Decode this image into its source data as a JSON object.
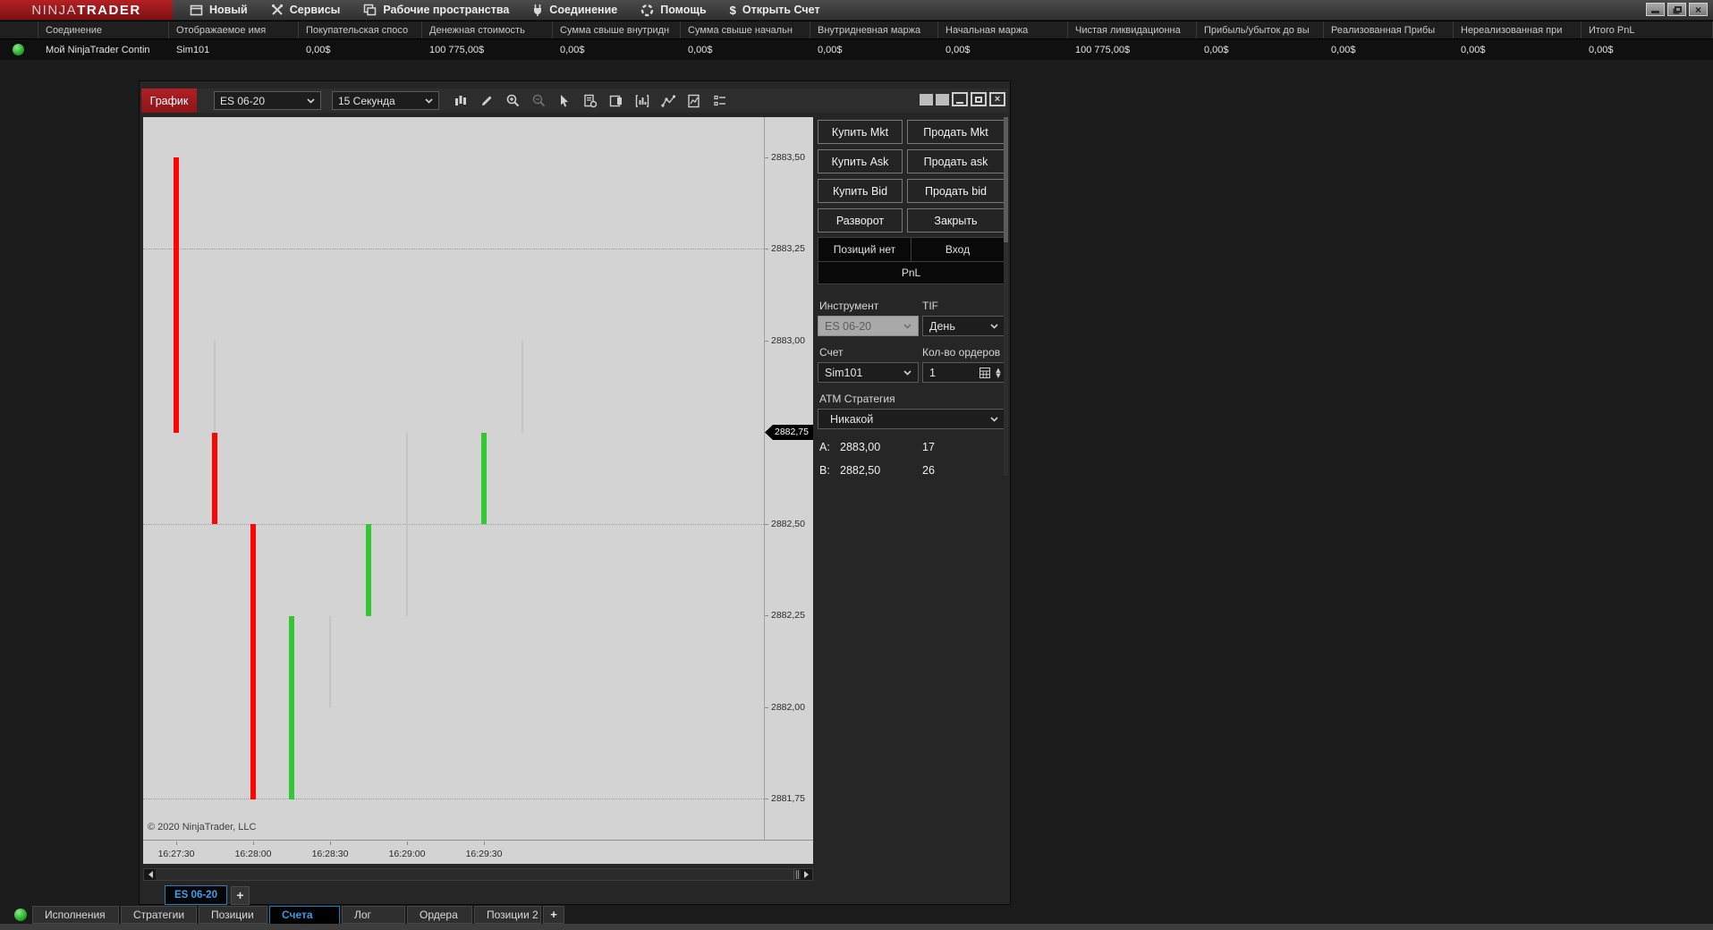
{
  "app": {
    "logo": {
      "ninja": "NINJA",
      "trader": "TRADER"
    },
    "menu": [
      {
        "label": "Новый",
        "icon": "new-window-icon"
      },
      {
        "label": "Сервисы",
        "icon": "tools-icon"
      },
      {
        "label": "Рабочие пространства",
        "icon": "workspaces-icon"
      },
      {
        "label": "Соединение",
        "icon": "plug-icon"
      },
      {
        "label": "Помощь",
        "icon": "help-icon"
      },
      {
        "label": "Открыть Счет",
        "icon": "dollar-icon"
      }
    ],
    "window_controls": [
      "minimize",
      "restore",
      "close"
    ]
  },
  "accounts_table": {
    "columns": [
      "Соединение",
      "Отображаемое имя",
      "Покупательская спосо",
      "Денежная стоимость",
      "Сумма свыше внутридн",
      "Сумма свыше начальн",
      "Внутридневная маржа",
      "Начальная маржа",
      "Чистая ликвидационна",
      "Прибыль/убыток до вы",
      "Реализованная Прибы",
      "Нереализованная при",
      "Итого PnL"
    ],
    "row": {
      "status_icon": "connection-status-green",
      "cells": [
        "Мой NinjaTrader Contin",
        "Sim101",
        "0,00$",
        "100 775,00$",
        "0,00$",
        "0,00$",
        "0,00$",
        "0,00$",
        "100 775,00$",
        "0,00$",
        "0,00$",
        "0,00$",
        "0,00$"
      ]
    }
  },
  "chart_window": {
    "tab_label": "График",
    "instrument_dropdown": "ES 06-20",
    "interval_dropdown": "15 Секунда",
    "toolbar_icons": [
      "chart-style-icon",
      "draw-icon",
      "zoom-in-icon",
      "zoom-out-icon",
      "cursor-icon",
      "data-box-icon",
      "chart-trader-icon",
      "indicators-icon",
      "line-tools-icon",
      "templates-icon",
      "properties-icon"
    ],
    "window_controls": [
      "square-toggle",
      "square-toggle",
      "minimize",
      "maximize",
      "close"
    ],
    "copyright": "© 2020 NinjaTrader, LLC",
    "bottom_tab": "ES 06-20",
    "add_tab_label": "+"
  },
  "order_panel": {
    "buttons": [
      "Купить Mkt",
      "Продать Mkt",
      "Купить Ask",
      "Продать ask",
      "Купить Bid",
      "Продать bid",
      "Разворот",
      "Закрыть"
    ],
    "position_status": "Позиций нет",
    "entry_label": "Вход",
    "pnl_label": "PnL",
    "instrument_label": "Инструмент",
    "instrument_value": "ES 06-20",
    "tif_label": "TIF",
    "tif_value": "День",
    "account_label": "Счет",
    "account_value": "Sim101",
    "qty_label": "Кол-во ордеров",
    "qty_value": "1",
    "atm_label": "АТМ Стратегия",
    "atm_value": "Никакой",
    "ask": {
      "label": "A:",
      "price": "2883,00",
      "size": "17"
    },
    "bid": {
      "label": "B:",
      "price": "2882,50",
      "size": "26"
    }
  },
  "bottom_tabs": {
    "items": [
      "Исполнения",
      "Стратегии",
      "Позиции",
      "Счета",
      "Лог",
      "Ордера",
      "Позиции 2"
    ],
    "selected_index": 3,
    "add_label": "+"
  },
  "chart_data": {
    "type": "ohlc-bar",
    "instrument": "ES 06-20",
    "interval": "15 Секунда",
    "ylim": [
      2881.64,
      2883.61
    ],
    "y_ticks": [
      {
        "price": 2883.5,
        "label": "2883,50"
      },
      {
        "price": 2883.25,
        "label": "2883,25"
      },
      {
        "price": 2883.0,
        "label": "2883,00"
      },
      {
        "price": 2882.75,
        "label": "2882,75"
      },
      {
        "price": 2882.5,
        "label": "2882,50"
      },
      {
        "price": 2882.25,
        "label": "2882,25"
      },
      {
        "price": 2882.0,
        "label": "2882,00"
      },
      {
        "price": 2881.75,
        "label": "2881,75"
      }
    ],
    "grid_prices": [
      2883.25,
      2882.5,
      2881.75
    ],
    "current_price": {
      "price": 2882.75,
      "label": "2882,75"
    },
    "x_labels": [
      {
        "time": "16:27:30",
        "slot": 0
      },
      {
        "time": "16:28:00",
        "slot": 2
      },
      {
        "time": "16:28:30",
        "slot": 4
      },
      {
        "time": "16:29:00",
        "slot": 6
      },
      {
        "time": "16:29:30",
        "slot": 8
      }
    ],
    "bars": [
      {
        "slot": 0,
        "time": "16:27:30",
        "open": 2883.5,
        "high": 2883.5,
        "low": 2882.75,
        "close": 2882.75,
        "direction": "down"
      },
      {
        "slot": 1,
        "time": "16:27:45",
        "open": 2882.75,
        "high": 2883.0,
        "low": 2882.5,
        "close": 2882.5,
        "direction": "down"
      },
      {
        "slot": 2,
        "time": "16:28:00",
        "open": 2882.5,
        "high": 2882.5,
        "low": 2881.75,
        "close": 2881.75,
        "direction": "down"
      },
      {
        "slot": 3,
        "time": "16:28:15",
        "open": 2881.75,
        "high": 2882.25,
        "low": 2881.75,
        "close": 2882.25,
        "direction": "up"
      },
      {
        "slot": 4,
        "time": "16:28:30",
        "open": null,
        "high": 2882.25,
        "low": 2882.0,
        "close": null,
        "direction": "flat"
      },
      {
        "slot": 5,
        "time": "16:28:45",
        "open": 2882.25,
        "high": 2882.5,
        "low": 2882.25,
        "close": 2882.5,
        "direction": "up"
      },
      {
        "slot": 6,
        "time": "16:29:00",
        "open": null,
        "high": 2882.75,
        "low": 2882.25,
        "close": null,
        "direction": "flat"
      },
      {
        "slot": 8,
        "time": "16:29:30",
        "open": 2882.5,
        "high": 2882.75,
        "low": 2882.5,
        "close": 2882.75,
        "direction": "up"
      },
      {
        "slot": 9,
        "time": "16:29:45",
        "open": null,
        "high": 2883.0,
        "low": 2882.75,
        "close": null,
        "direction": "flat"
      }
    ],
    "colors": {
      "up": "#32c832",
      "down": "#fe0505",
      "flat": "#c4c4c4",
      "plot_bg": "#d3d3d3",
      "axis_text": "#2b2b2b"
    }
  }
}
